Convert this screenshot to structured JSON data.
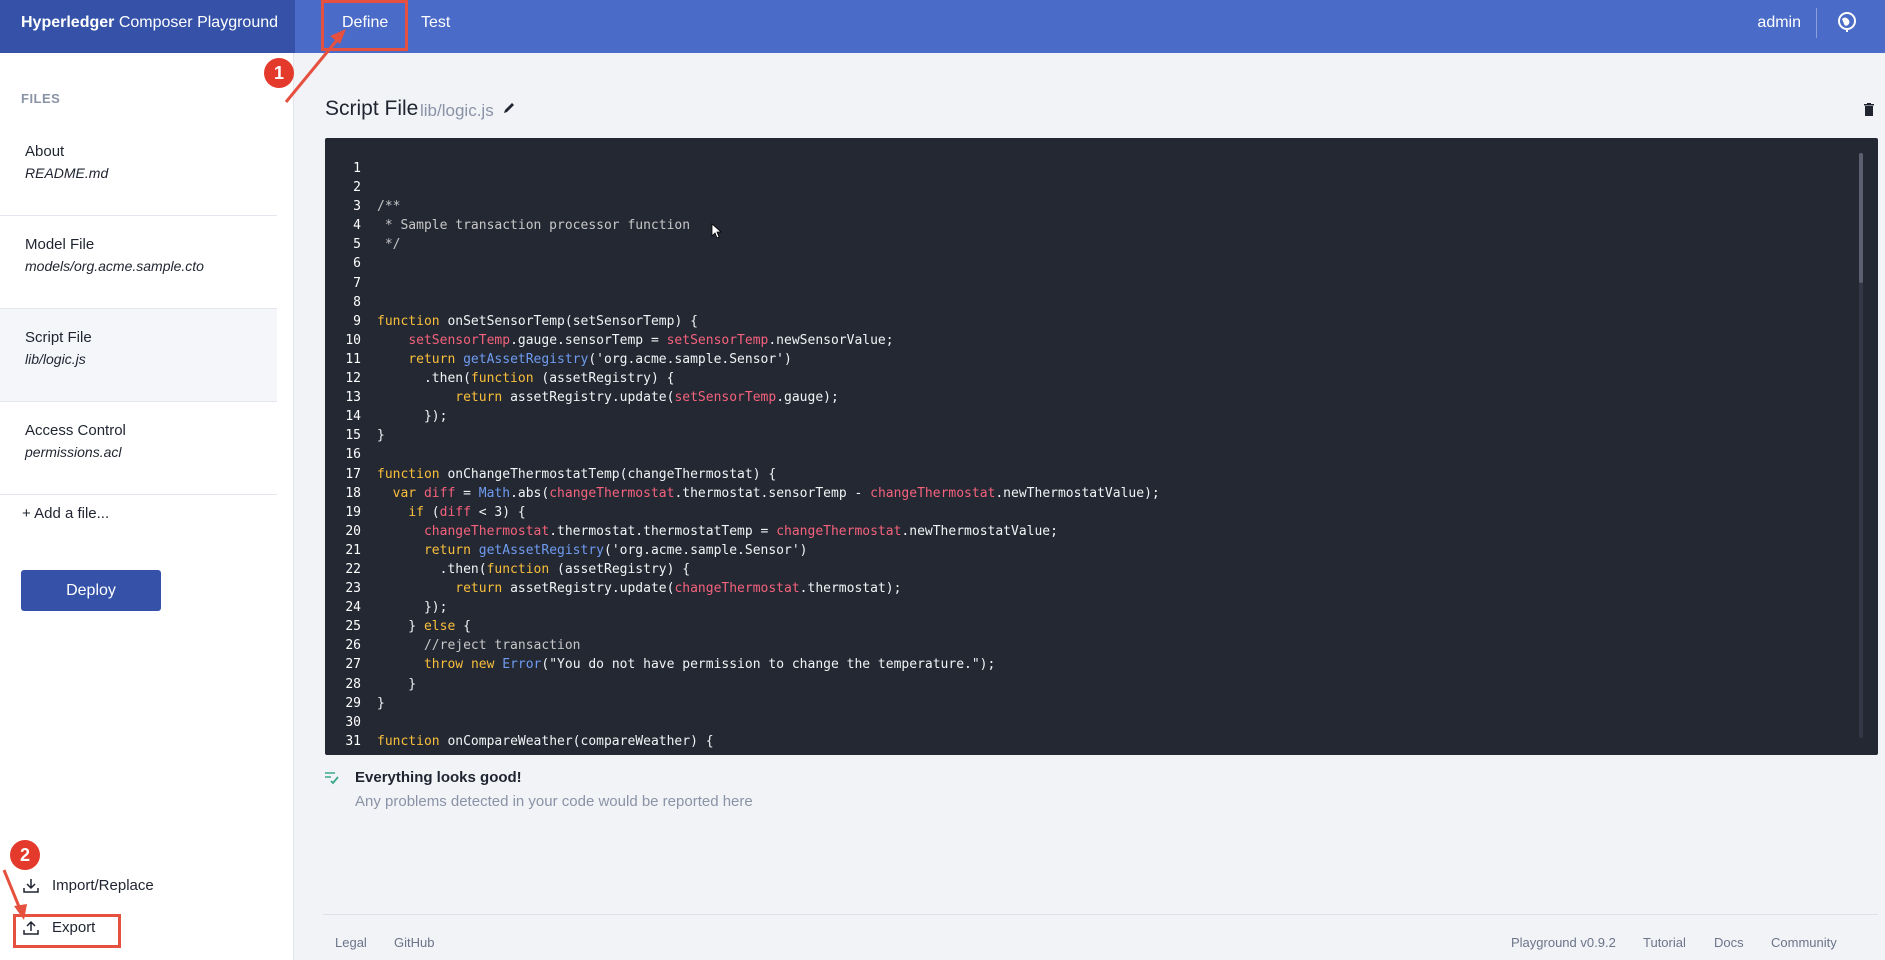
{
  "topbar": {
    "brand_bold": "Hyperledger",
    "brand_rest": " Composer Playground",
    "tabs": [
      {
        "label": "Define"
      },
      {
        "label": "Test"
      }
    ],
    "user": "admin"
  },
  "sidebar": {
    "title": "FILES",
    "files": [
      {
        "name": "About",
        "path": "README.md"
      },
      {
        "name": "Model File",
        "path": "models/org.acme.sample.cto"
      },
      {
        "name": "Script File",
        "path": "lib/logic.js"
      },
      {
        "name": "Access Control",
        "path": "permissions.acl"
      }
    ],
    "add_file": "+ Add a file...",
    "deploy": "Deploy",
    "import": "Import/Replace",
    "export": "Export"
  },
  "editor": {
    "title": "Script File",
    "path": "lib/logic.js",
    "code_lines": [
      "",
      "",
      "/**",
      " * Sample transaction processor function",
      " */",
      "",
      "",
      "",
      "function onSetSensorTemp(setSensorTemp) {",
      "    setSensorTemp.gauge.sensorTemp = setSensorTemp.newSensorValue;",
      "    return getAssetRegistry('org.acme.sample.Sensor')",
      "      .then(function (assetRegistry) {",
      "          return assetRegistry.update(setSensorTemp.gauge);",
      "      });",
      "}",
      "",
      "function onChangeThermostatTemp(changeThermostat) {",
      "  var diff = Math.abs(changeThermostat.thermostat.sensorTemp - changeThermostat.newThermostatValue);",
      "    if (diff < 3) {",
      "      changeThermostat.thermostat.thermostatTemp = changeThermostat.newThermostatValue;",
      "      return getAssetRegistry('org.acme.sample.Sensor')",
      "        .then(function (assetRegistry) {",
      "          return assetRegistry.update(changeThermostat.thermostat);",
      "      });",
      "    } else {",
      "      //reject transaction",
      "      throw new Error(\"You do not have permission to change the temperature.\");",
      "    }",
      "}",
      "",
      "function onCompareWeather(compareWeather) {"
    ]
  },
  "status": {
    "title": "Everything looks good!",
    "subtitle": "Any problems detected in your code would be reported here"
  },
  "footer": {
    "legal": "Legal",
    "github": "GitHub",
    "version": "Playground v0.9.2",
    "tutorial": "Tutorial",
    "docs": "Docs",
    "community": "Community"
  },
  "annotations": {
    "one": "1",
    "two": "2"
  }
}
